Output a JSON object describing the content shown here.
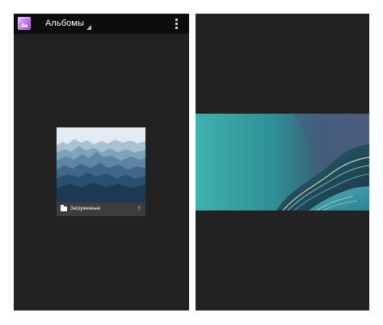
{
  "left_screen": {
    "action_bar": {
      "title": "Альбомы",
      "app_icon": "gallery-app-icon",
      "spinner_icon": "spinner-triangle-icon",
      "overflow_icon": "overflow-menu-icon"
    },
    "albums": [
      {
        "name": "Загруженные",
        "count": "5",
        "folder_icon": "folder-icon",
        "thumbnail": "mountain-layers-image"
      }
    ]
  },
  "right_screen": {
    "photo": "teal-abstract-wallpaper-image"
  },
  "colors": {
    "screen_background": "#222222",
    "action_bar": "#0d0d0d",
    "caption_bar": "#3d3d3f",
    "teal_accent": "#3aa7a8"
  }
}
